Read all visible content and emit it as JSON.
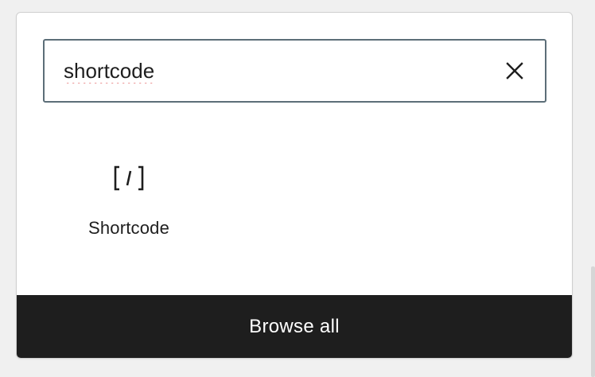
{
  "search": {
    "value": "shortcode",
    "clear_icon": "close-icon"
  },
  "results": [
    {
      "label": "Shortcode",
      "icon": "shortcode-icon"
    }
  ],
  "footer": {
    "browse_all_label": "Browse all"
  },
  "colors": {
    "input_border": "#5c6e78",
    "footer_background": "#1e1e1e",
    "footer_text": "#ffffff",
    "text": "#1e1e1e",
    "spellcheck_underline": "#e05555"
  }
}
